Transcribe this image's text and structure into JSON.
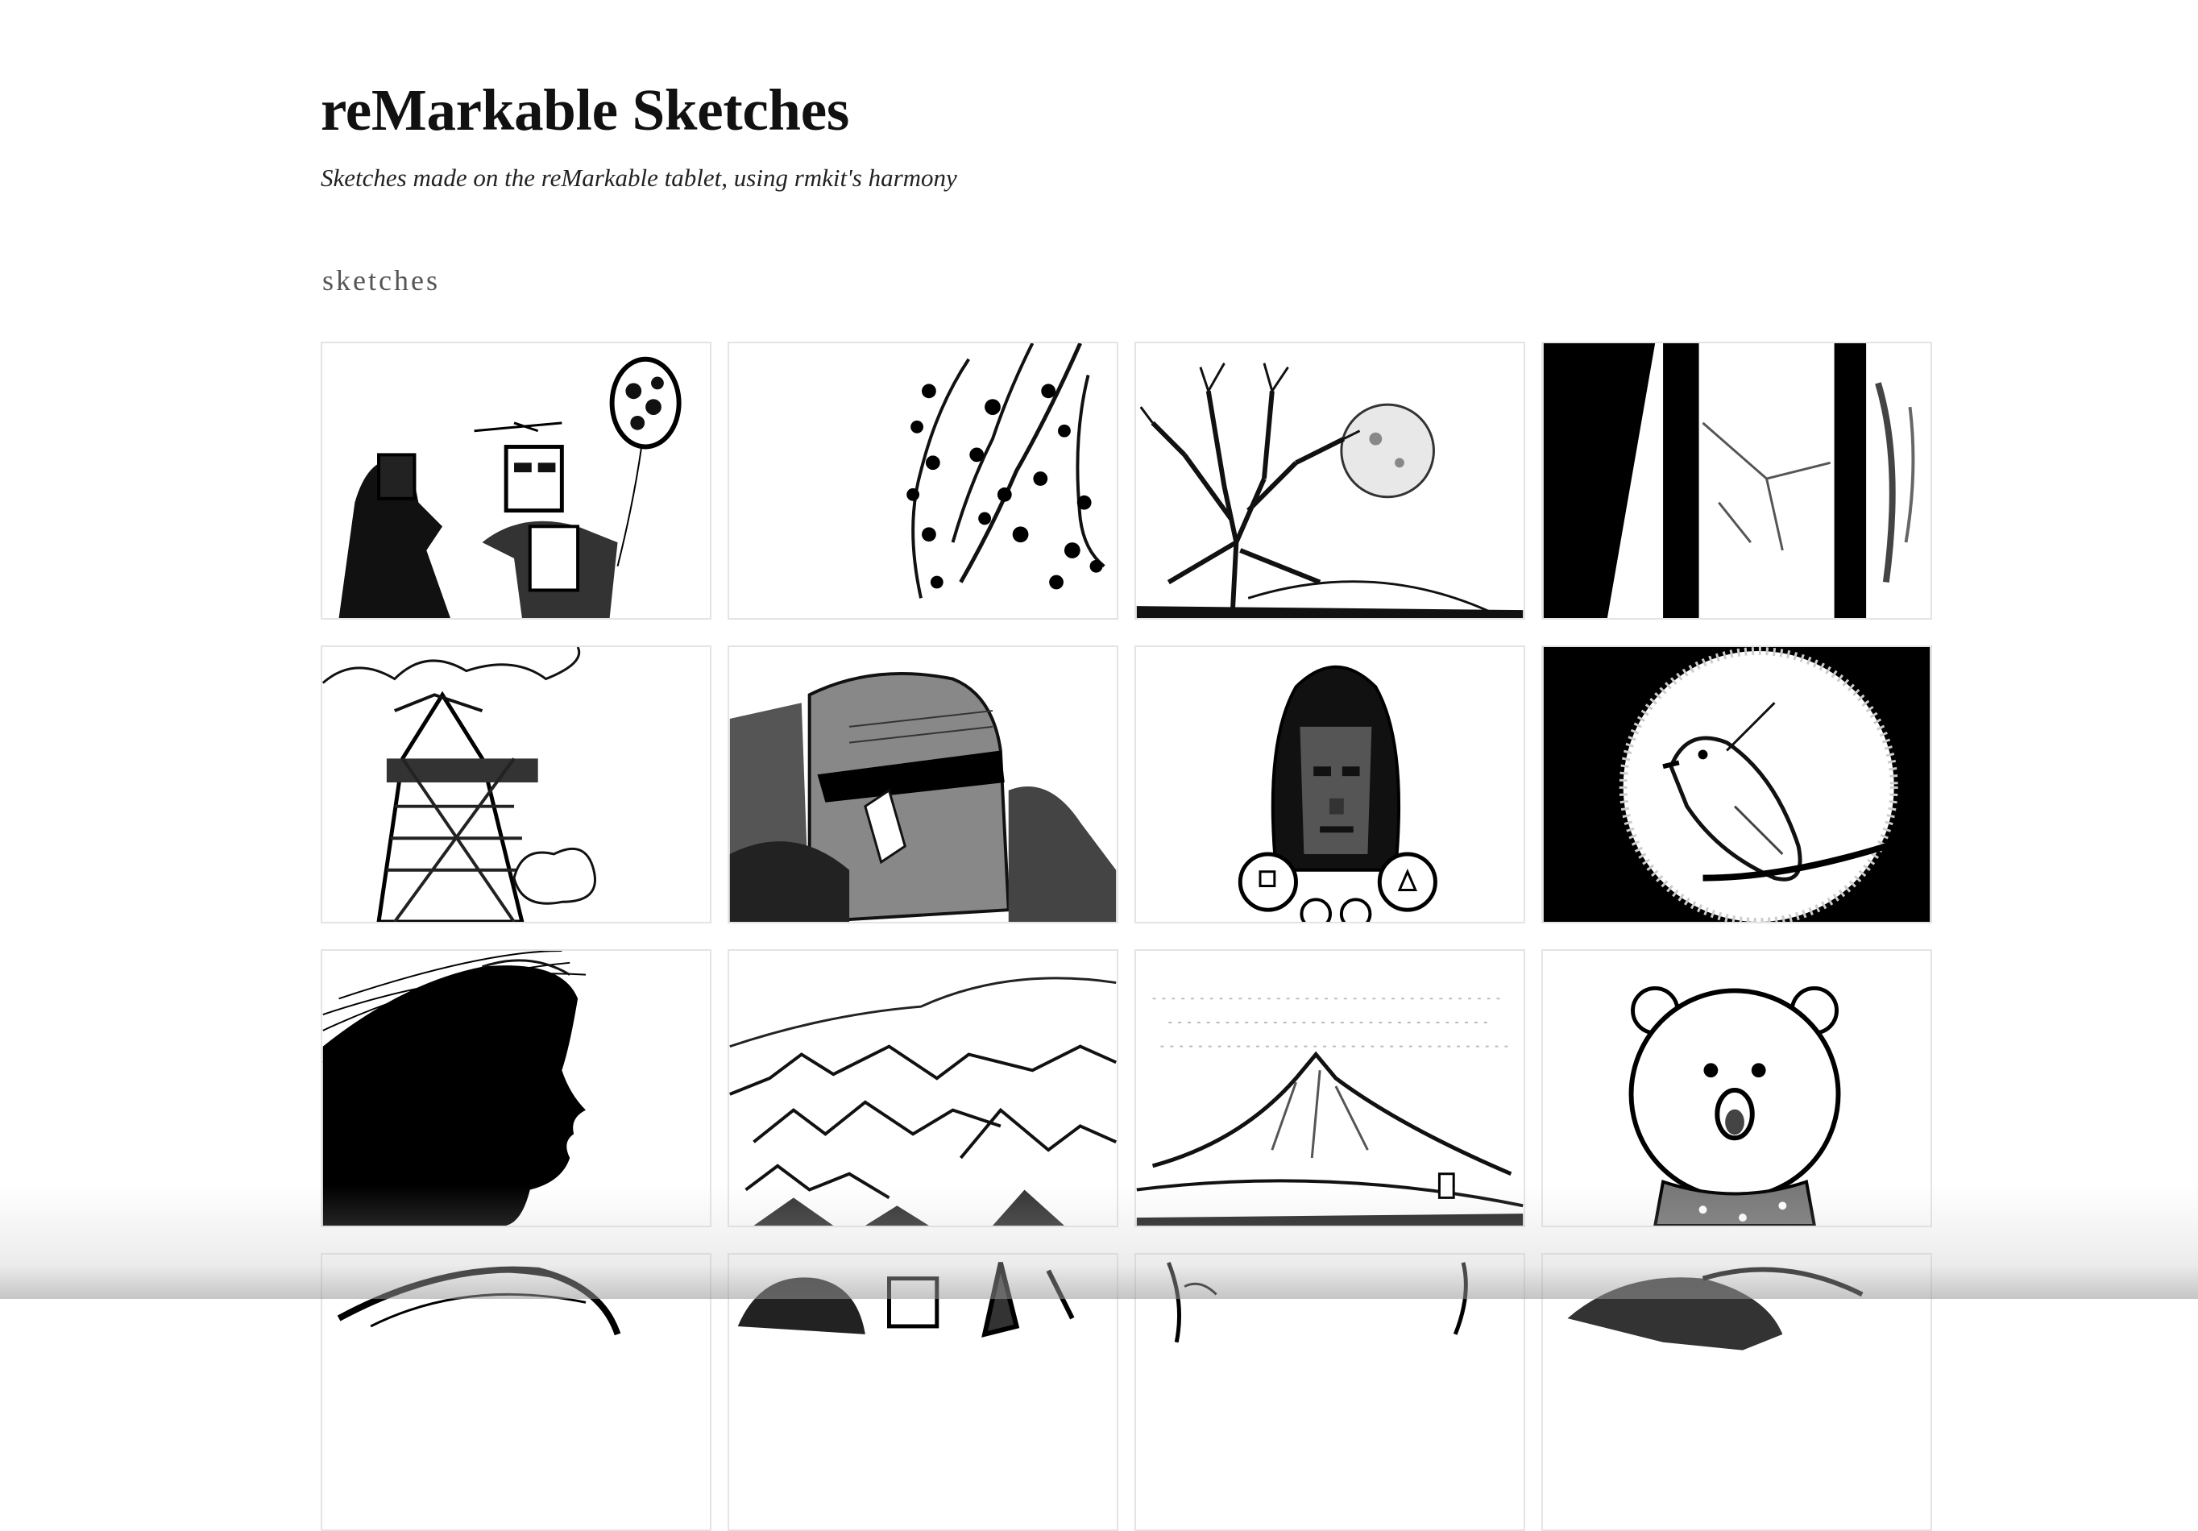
{
  "site": {
    "title": "reMarkable Sketches",
    "subtitle": "Sketches made on the reMarkable tablet, using rmkit's harmony"
  },
  "section": {
    "label": "sketches"
  },
  "sketches": [
    {
      "subject": "astronaut-and-robot-with-balloon"
    },
    {
      "subject": "blossom-branches"
    },
    {
      "subject": "bare-tree-and-moon"
    },
    {
      "subject": "tree-trunks-bark"
    },
    {
      "subject": "eiffel-tower-clouds"
    },
    {
      "subject": "moai-head"
    },
    {
      "subject": "masked-guard"
    },
    {
      "subject": "bird-on-branch-moon"
    },
    {
      "subject": "windswept-hair-profile"
    },
    {
      "subject": "mountain-ranges"
    },
    {
      "subject": "mountain-landscape"
    },
    {
      "subject": "bear-face"
    },
    {
      "subject": "hair-sketch"
    },
    {
      "subject": "creature-sketch"
    },
    {
      "subject": "line-sketch"
    },
    {
      "subject": "abstract-sketch"
    }
  ]
}
